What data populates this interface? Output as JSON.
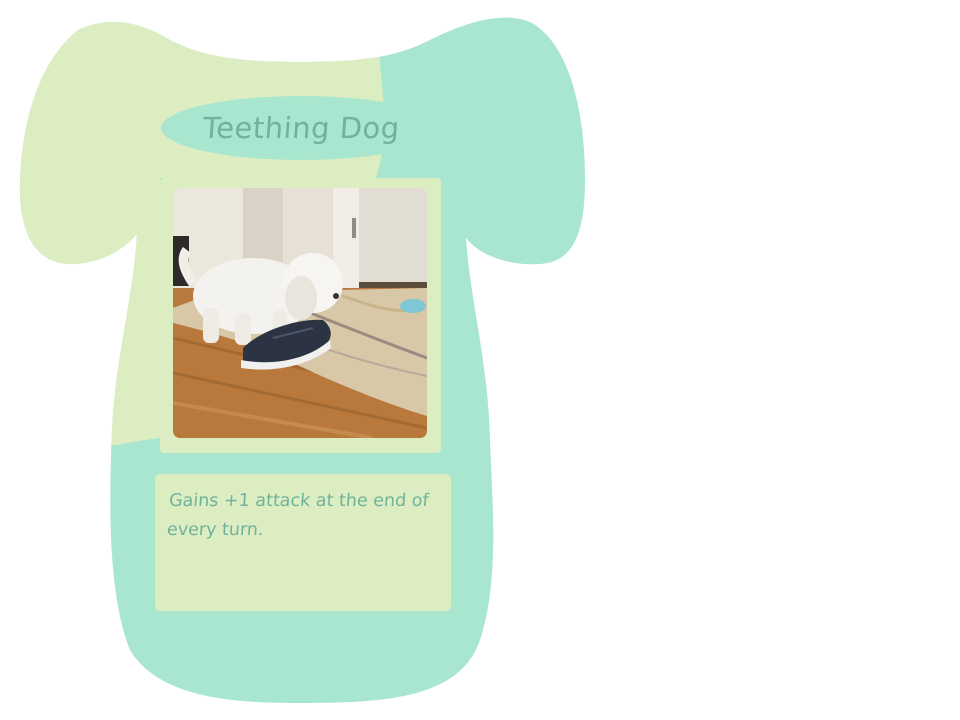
{
  "card": {
    "title": "Teething Dog",
    "description": "Gains +1 attack at the end of every turn.",
    "artwork": "photo of a small white dog chewing a black sneaker on a hardwood floor"
  },
  "colors": {
    "card_teal": "#a8e6cf",
    "card_pale_green": "#dcedc1",
    "text": "#6fb39c",
    "background": "#ffffff"
  }
}
